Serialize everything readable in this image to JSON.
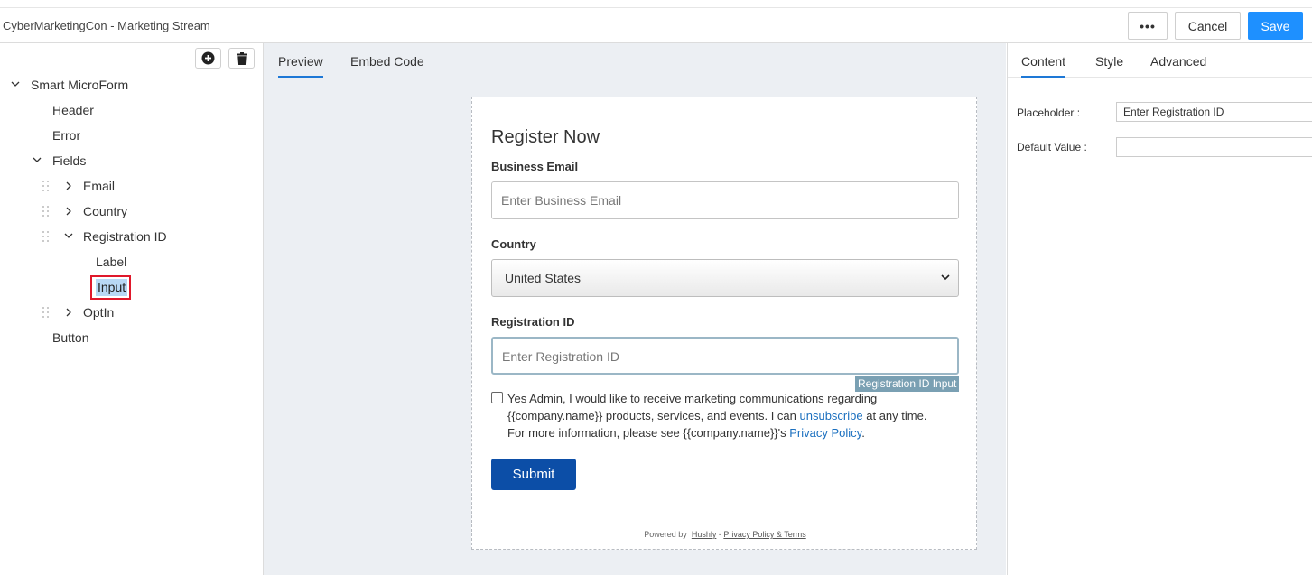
{
  "header": {
    "title": "CyberMarketingCon - Marketing Stream",
    "more_label": "•••",
    "cancel_label": "Cancel",
    "save_label": "Save",
    "save_color": "#1e90ff"
  },
  "tree": {
    "root": "Smart MicroForm",
    "header": "Header",
    "error": "Error",
    "fields": "Fields",
    "email": "Email",
    "country": "Country",
    "registration_id": "Registration ID",
    "label": "Label",
    "input": "Input",
    "optin": "OptIn",
    "button": "Button"
  },
  "center_tabs": {
    "preview": "Preview",
    "embed": "Embed Code"
  },
  "form": {
    "title": "Register Now",
    "email_label": "Business Email",
    "email_placeholder": "Enter Business Email",
    "country_label": "Country",
    "country_value": "United States",
    "regid_label": "Registration ID",
    "regid_placeholder": "Enter Registration ID",
    "hover_tag": "Registration ID Input",
    "optin_part1": "Yes Admin, I would like to receive marketing communications regarding {{company.name}} products, services, and events. I can ",
    "optin_unsubscribe": "unsubscribe",
    "optin_part2": " at any time. For more information, please see {{company.name}}'s ",
    "optin_privacy": "Privacy Policy",
    "optin_end": ".",
    "submit_label": "Submit",
    "submit_color": "#0c4ea7",
    "powered_by": "Powered by",
    "hushly": "Hushly",
    "dash": " - ",
    "privacy_terms": "Privacy Policy & Terms"
  },
  "right_tabs": {
    "content": "Content",
    "style": "Style",
    "advanced": "Advanced"
  },
  "props": {
    "placeholder_label": "Placeholder",
    "placeholder_value": "Enter Registration ID",
    "default_label": "Default Value",
    "default_value": "",
    "colon": ":"
  }
}
